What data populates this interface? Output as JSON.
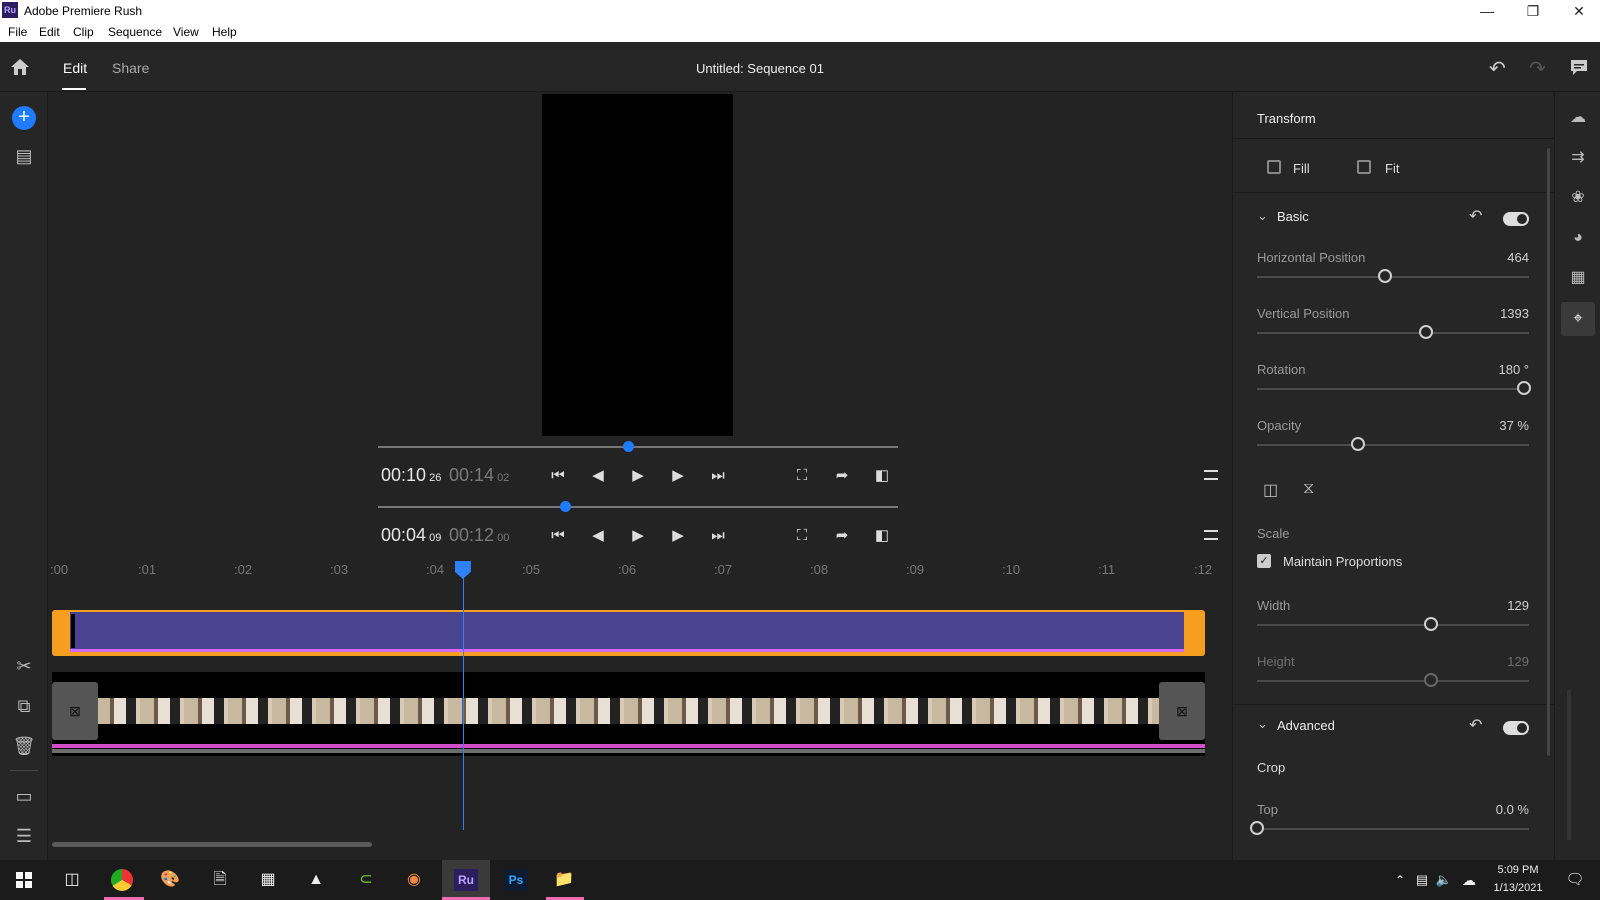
{
  "window": {
    "title": "Adobe Premiere Rush",
    "app_badge": "Ru"
  },
  "menu": [
    "File",
    "Edit",
    "Clip",
    "Sequence",
    "View",
    "Help"
  ],
  "header": {
    "tabs": [
      "Edit",
      "Share"
    ],
    "active_tab": "Edit",
    "sequence_title": "Untitled: Sequence 01"
  },
  "player1": {
    "current": "00:10",
    "current_frames": "26",
    "duration": "00:14",
    "duration_frames": "02",
    "progress": 0.48
  },
  "player2": {
    "current": "00:04",
    "current_frames": "09",
    "duration": "00:12",
    "duration_frames": "00",
    "progress": 0.36
  },
  "ruler": [
    ":00",
    ":01",
    ":02",
    ":03",
    ":04",
    ":05",
    ":06",
    ":07",
    ":08",
    ":09",
    ":10",
    ":11",
    ":12"
  ],
  "playhead_time": 4.28,
  "transform": {
    "title": "Transform",
    "fill_label": "Fill",
    "fit_label": "Fit",
    "basic_label": "Basic",
    "hpos": {
      "label": "Horizontal Position",
      "value": "464",
      "level": 0.47
    },
    "vpos": {
      "label": "Vertical Position",
      "value": "1393",
      "level": 0.62
    },
    "rotation": {
      "label": "Rotation",
      "value": "180 °",
      "level": 0.98
    },
    "opacity": {
      "label": "Opacity",
      "value": "37 %",
      "level": 0.37
    },
    "scale_label": "Scale",
    "maintain_label": "Maintain Proportions",
    "width": {
      "label": "Width",
      "value": "129",
      "level": 0.64
    },
    "height": {
      "label": "Height",
      "value": "129",
      "level": 0.64
    },
    "advanced_label": "Advanced",
    "crop_label": "Crop",
    "top": {
      "label": "Top",
      "value": "0.0 %",
      "level": 0.0
    }
  },
  "taskbar": {
    "time": "5:09 PM",
    "date": "1/13/2021",
    "ru_label": "Ru",
    "ps_label": "Ps"
  },
  "colors": {
    "accent": "#1f7bff",
    "clip_border": "#f59e1f",
    "clip_fill": "#4a4390",
    "audio": "#d24fc9"
  }
}
